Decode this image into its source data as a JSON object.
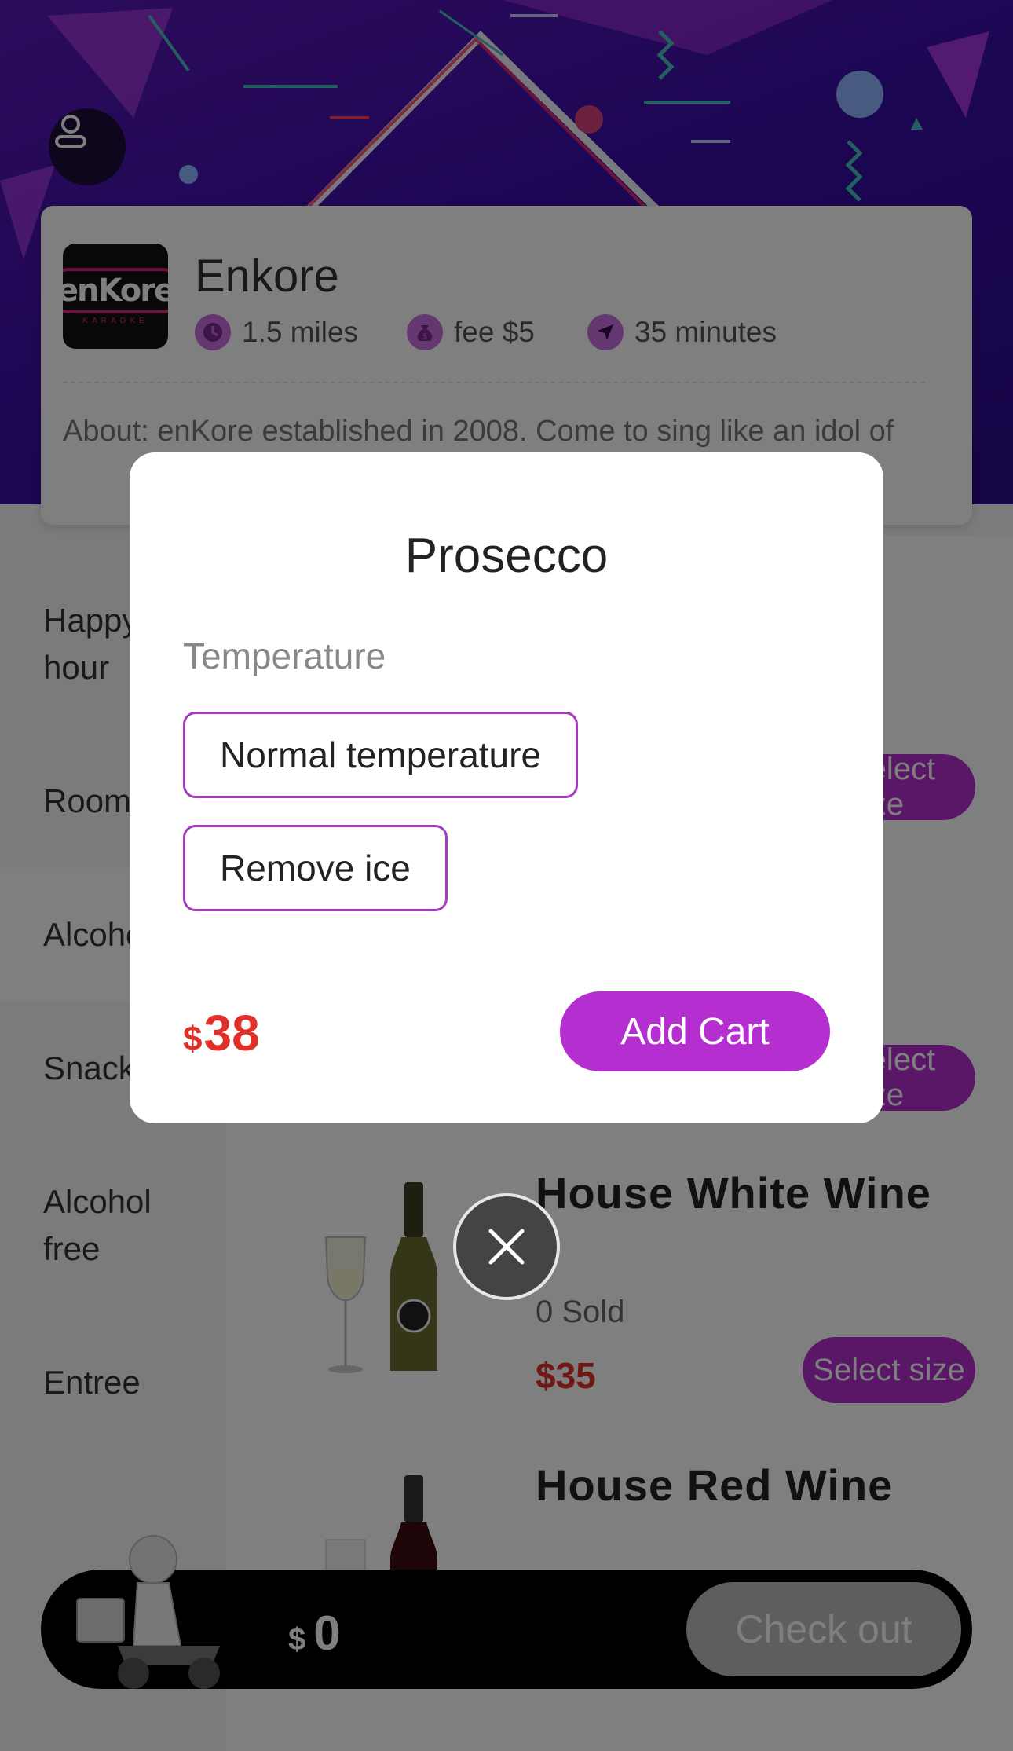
{
  "shop": {
    "name": "Enkore",
    "logo_text": "enKore",
    "logo_sub": "KARAOKE",
    "distance": "1.5 miles",
    "fee": "fee $5",
    "time": "35 minutes",
    "about": "About: enKore established in 2008. Come to sing like an idol of"
  },
  "categories": [
    "Happy hour",
    "Room",
    "Alcohol",
    "Snack",
    "Alcohol free",
    "Entree"
  ],
  "products": [
    {
      "select_label": "Select size"
    },
    {
      "select_label": "Select size"
    },
    {
      "name": "House White Wine",
      "sold": "0 Sold",
      "price": "$35",
      "select_label": "Select size"
    },
    {
      "name": "House Red Wine"
    }
  ],
  "cart": {
    "currency": "$",
    "total": "0",
    "checkout_label": "Check out"
  },
  "modal": {
    "title": "Prosecco",
    "spec_label": "Temperature",
    "options": [
      "Normal temperature",
      "Remove ice"
    ],
    "price_currency": "$",
    "price_amount": "38",
    "add_cart_label": "Add Cart"
  },
  "colors": {
    "accent": "#b52fd0",
    "price": "#e0302a",
    "banner": "#3a0ea8"
  },
  "icons": [
    "user-icon",
    "clock-icon",
    "money-bag-icon",
    "navigation-arrow-icon",
    "close-icon"
  ]
}
